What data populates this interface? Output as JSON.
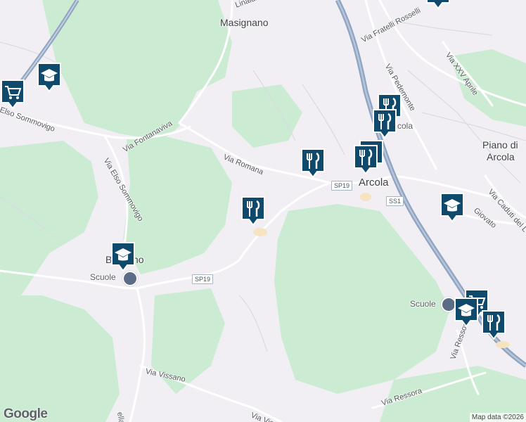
{
  "map": {
    "colors": {
      "land": "#f1eff3",
      "forest": "#cbecd2",
      "highway": "#8fa4c3",
      "road": "#ffffff",
      "minor_road": "#d8dae0",
      "pin": "#0f4a6c"
    },
    "places": {
      "masignano": "Masignano",
      "arcola": "Arcola",
      "piano_line1": "Piano di",
      "piano_line2": "Arcola",
      "baccano": "Baccano",
      "arcola_partial": "cola"
    },
    "schools": {
      "baccano": "Scuole",
      "arcola": "Scuole"
    },
    "streets": {
      "fratelli_rosselli": "Via Fratelli Rosselli",
      "xxv_aprile": "Via XXV Aprile",
      "pedemonte": "Via Pedemonte",
      "elso_sommovigo_1": "Elso Sommovigo",
      "elso_sommovigo_2": "Via Elso Sommovigo",
      "fontanaviva": "Via Fontanaviva",
      "romana": "Via Romana",
      "caduti_del_la": "Via Caduti del L",
      "giovato": "Giovato",
      "ressora_1": "Via Ressora",
      "ressora_2": "Via Ressora",
      "vissano_1": "Via Vissano",
      "vissano_2": "Via Vis",
      "partial_linaldi": "Linaldi",
      "partial_ella": "ella"
    },
    "shields": {
      "sp19_a": "SP19",
      "sp19_b": "SP19",
      "ss1": "SS1"
    },
    "pins": [
      {
        "id": "school-1",
        "icon": "school-icon"
      },
      {
        "id": "shop-1",
        "icon": "cart-icon"
      },
      {
        "id": "food-1",
        "icon": "restaurant-icon"
      },
      {
        "id": "food-2",
        "icon": "restaurant-icon"
      },
      {
        "id": "food-3",
        "icon": "restaurant-icon"
      },
      {
        "id": "food-4",
        "icon": "restaurant-icon"
      },
      {
        "id": "food-5",
        "icon": "restaurant-icon"
      },
      {
        "id": "school-2",
        "icon": "school-icon"
      },
      {
        "id": "school-3",
        "icon": "school-icon"
      },
      {
        "id": "school-4",
        "icon": "school-icon"
      },
      {
        "id": "shop-2",
        "icon": "cart-icon"
      },
      {
        "id": "food-6",
        "icon": "restaurant-icon"
      },
      {
        "id": "food-7",
        "icon": "restaurant-icon"
      }
    ],
    "logo": "Google",
    "attribution": "Map data ©2026"
  }
}
